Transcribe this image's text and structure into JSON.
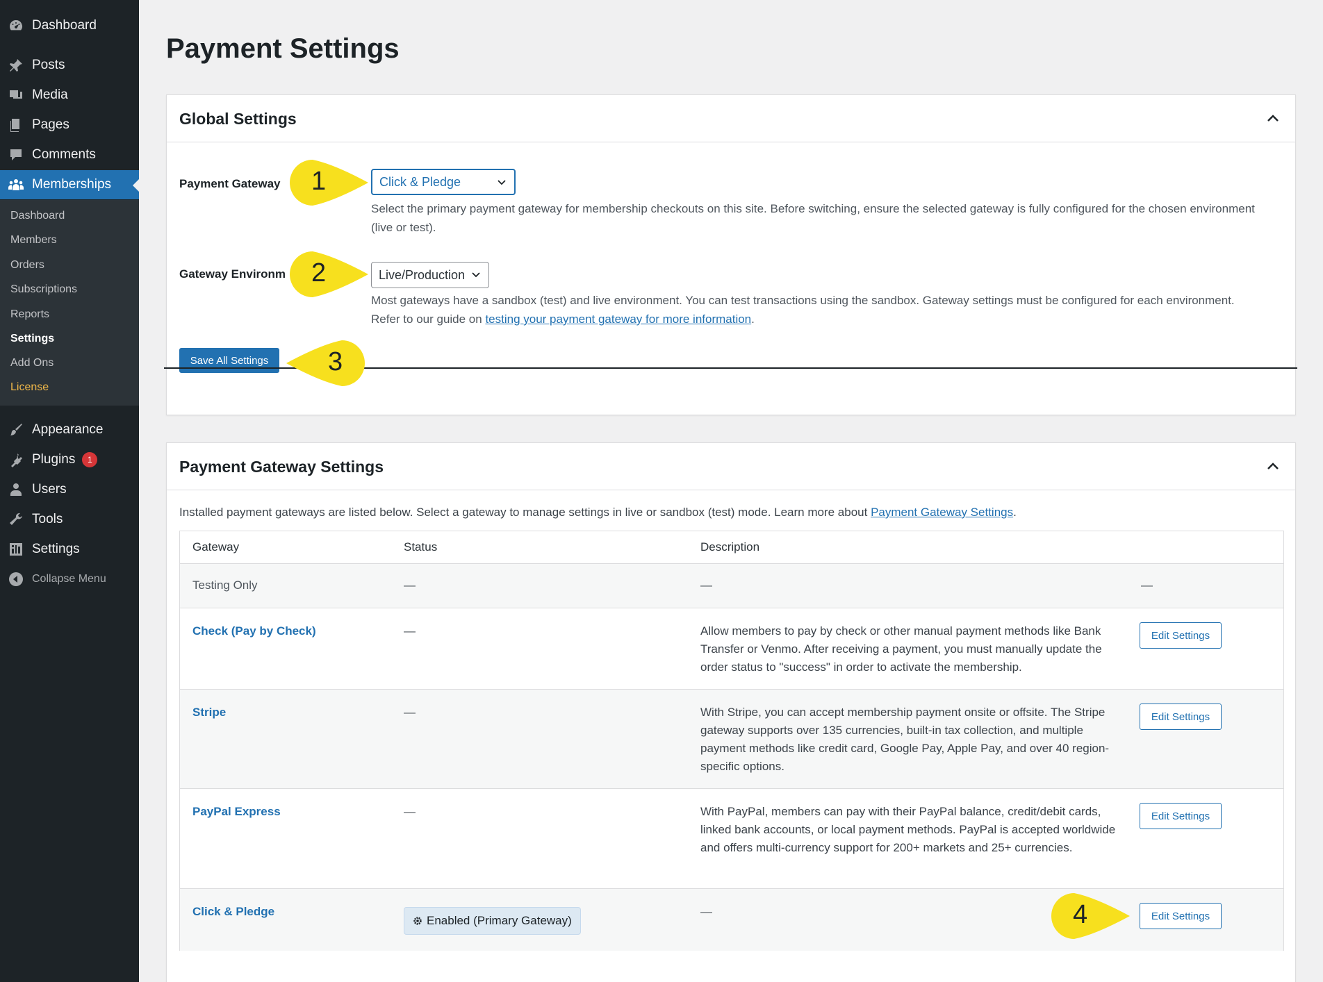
{
  "sidebar": {
    "top_items": [
      {
        "label": "Dashboard",
        "icon": "dashboard-icon"
      },
      {
        "label": "Posts",
        "icon": "pin-icon"
      },
      {
        "label": "Media",
        "icon": "media-icon"
      },
      {
        "label": "Pages",
        "icon": "pages-icon"
      },
      {
        "label": "Comments",
        "icon": "comments-icon"
      },
      {
        "label": "Memberships",
        "icon": "groups-icon"
      }
    ],
    "submenu": [
      "Dashboard",
      "Members",
      "Orders",
      "Subscriptions",
      "Reports",
      "Settings",
      "Add Ons",
      "License"
    ],
    "bottom_items": [
      {
        "label": "Appearance",
        "icon": "brush-icon"
      },
      {
        "label": "Plugins",
        "icon": "plugin-icon",
        "badge": "1"
      },
      {
        "label": "Users",
        "icon": "users-icon"
      },
      {
        "label": "Tools",
        "icon": "wrench-icon"
      },
      {
        "label": "Settings",
        "icon": "settings-icon"
      }
    ],
    "collapse_label": "Collapse Menu"
  },
  "page": {
    "title": "Payment Settings"
  },
  "global_settings": {
    "title": "Global Settings",
    "payment_gateway_label": "Payment Gateway",
    "payment_gateway_value": "Click & Pledge",
    "payment_gateway_help": "Select the primary payment gateway for membership checkouts on this site. Before switching, ensure the selected gateway is fully configured for the chosen environment (live or test).",
    "environment_label": "Gateway Environment",
    "environment_value": "Live/Production",
    "environment_help_1": "Most gateways have a sandbox (test) and live environment. You can test transactions using the sandbox. Gateway settings must be configured for each environment.",
    "environment_help_2_prefix": "Refer to our guide on ",
    "environment_help_link": "testing your payment gateway for more information",
    "environment_help_suffix": ".",
    "save_label": "Save All Settings"
  },
  "gateway_settings": {
    "title": "Payment Gateway Settings",
    "intro_prefix": "Installed payment gateways are listed below. Select a gateway to manage settings in live or sandbox (test) mode. Learn more about ",
    "intro_link": "Payment Gateway Settings",
    "intro_suffix": ".",
    "columns": [
      "Gateway",
      "Status",
      "Description"
    ],
    "rows": [
      {
        "name": "Testing Only",
        "status": "—",
        "description": "—",
        "action": "—"
      },
      {
        "name": "Check (Pay by Check)",
        "status": "—",
        "description": "Allow members to pay by check or other manual payment methods like Bank Transfer or Venmo. After receiving a payment, you must manually update the order status to \"success\" in order to activate the membership.",
        "action": "Edit Settings"
      },
      {
        "name": "Stripe",
        "status": "—",
        "description": "With Stripe, you can accept membership payment onsite or offsite. The Stripe gateway supports over 135 currencies, built-in tax collection, and multiple payment methods like credit card, Google Pay, Apple Pay, and over 40 region-specific options.",
        "action": "Edit Settings"
      },
      {
        "name": "PayPal Express",
        "status": "—",
        "description": "With PayPal, members can pay with their PayPal balance, credit/debit cards, linked bank accounts, or local payment methods. PayPal is accepted worldwide and offers multi-currency support for 200+ markets and 25+ currencies.",
        "action": "Edit Settings"
      },
      {
        "name": "Click & Pledge",
        "status": "Enabled (Primary Gateway)",
        "description": "—",
        "action": "Edit Settings"
      }
    ]
  },
  "callouts": [
    "1",
    "2",
    "3",
    "4"
  ],
  "colors": {
    "accent": "#2271b1",
    "sidebar": "#1d2327",
    "callout": "#f7e01e"
  }
}
